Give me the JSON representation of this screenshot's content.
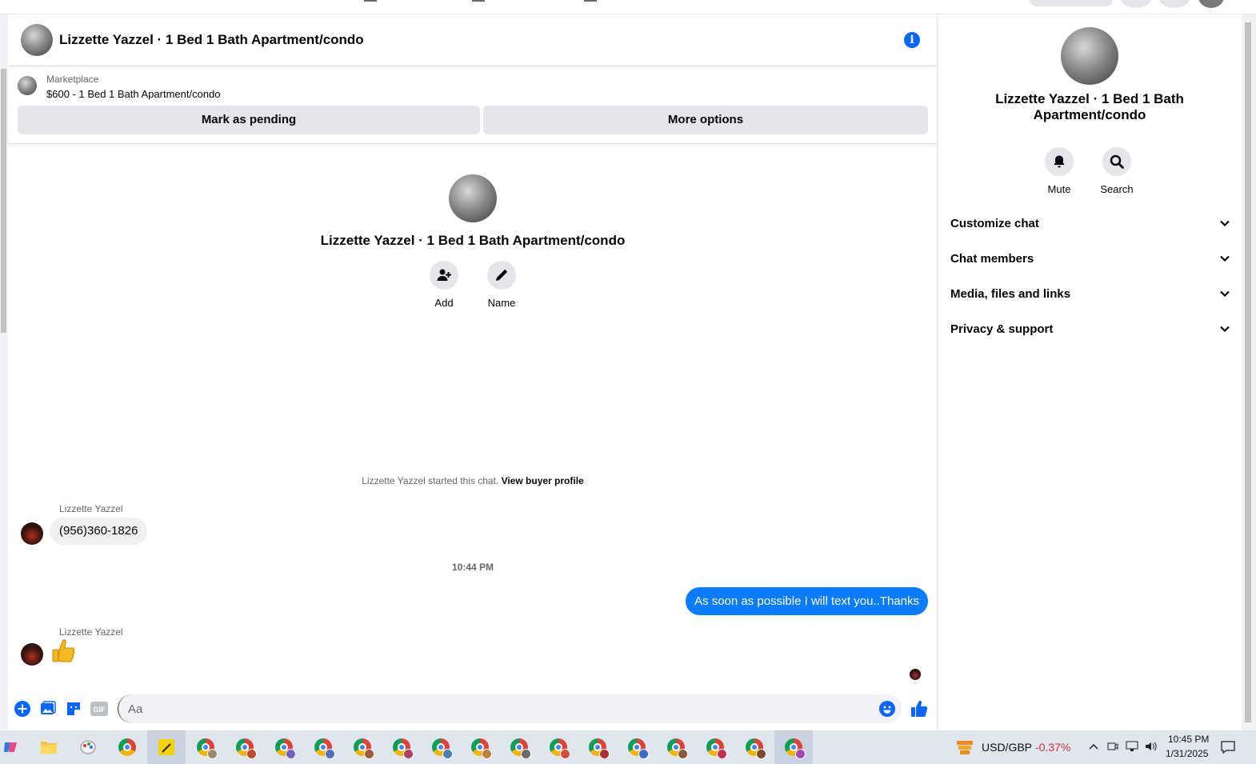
{
  "header": {
    "title": "Lizzette Yazzel · 1 Bed 1 Bath Apartment/condo"
  },
  "marketplace": {
    "label": "Marketplace",
    "listing": "$600 - 1 Bed 1 Bath Apartment/condo",
    "mark_pending": "Mark as pending",
    "more_options": "More options"
  },
  "intro": {
    "name": "Lizzette Yazzel · 1 Bed 1 Bath Apartment/condo",
    "add_label": "Add",
    "name_label": "Name"
  },
  "messages": {
    "started_text": "Lizzette Yazzel started this chat.",
    "view_profile": "View buyer profile",
    "sender1": "Lizzette Yazzel",
    "msg1": "(956)360-1826",
    "timestamp": "10:44 PM",
    "msg2": "As soon as possible I will text you..Thanks",
    "sender2": "Lizzette Yazzel",
    "msg3": "👍"
  },
  "composer": {
    "placeholder": "Aa"
  },
  "info_panel": {
    "name": "Lizzette Yazzel · 1 Bed 1 Bath Apartment/condo",
    "mute_label": "Mute",
    "search_label": "Search",
    "sections": [
      {
        "label": "Customize chat"
      },
      {
        "label": "Chat members"
      },
      {
        "label": "Media, files and links"
      },
      {
        "label": "Privacy & support"
      }
    ]
  },
  "taskbar": {
    "stock_label": "USD/GBP",
    "stock_change": "-0.37%",
    "time": "10:45 PM",
    "date": "1/31/2025"
  },
  "colors": {
    "accent": "#0866ff",
    "outgoing_bubble": "#0a7cff",
    "stock_negative": "#d13438"
  }
}
